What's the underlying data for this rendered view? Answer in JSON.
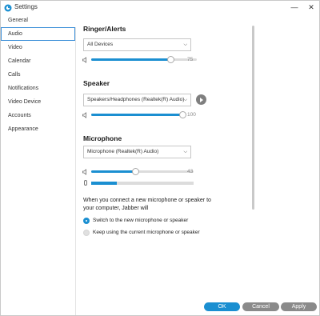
{
  "window": {
    "title": "Settings",
    "minimize_glyph": "—",
    "close_glyph": "✕"
  },
  "sidebar": {
    "items": [
      {
        "label": "General",
        "active": false
      },
      {
        "label": "Audio",
        "active": true
      },
      {
        "label": "Video",
        "active": false
      },
      {
        "label": "Calendar",
        "active": false
      },
      {
        "label": "Calls",
        "active": false
      },
      {
        "label": "Notifications",
        "active": false
      },
      {
        "label": "Video Device",
        "active": false
      },
      {
        "label": "Accounts",
        "active": false
      },
      {
        "label": "Appearance",
        "active": false
      }
    ]
  },
  "ringer": {
    "title": "Ringer/Alerts",
    "device": "All Devices",
    "volume": 75
  },
  "speaker": {
    "title": "Speaker",
    "device": "Speakers/Headphones (Realtek(R) Audio)",
    "volume": 100
  },
  "microphone": {
    "title": "Microphone",
    "device": "Microphone (Realtek(R) Audio)",
    "volume": 43,
    "input_level": 0.25,
    "connect_text": "When you connect a new microphone or speaker to your computer, Jabber will",
    "options": [
      {
        "label": "Switch to the new microphone or speaker",
        "selected": true
      },
      {
        "label": "Keep using the current microphone or speaker",
        "selected": false
      }
    ]
  },
  "footer": {
    "ok_label": "OK",
    "cancel_label": "Cancel",
    "apply_label": "Apply"
  },
  "colors": {
    "accent": "#1b8fd1",
    "button_gray": "#8a8a8a"
  },
  "icons": {
    "app": "jabber-logo-icon",
    "dropdown": "chevron-down-icon",
    "volume": "speaker-icon",
    "play": "play-icon",
    "mic": "microphone-icon"
  }
}
